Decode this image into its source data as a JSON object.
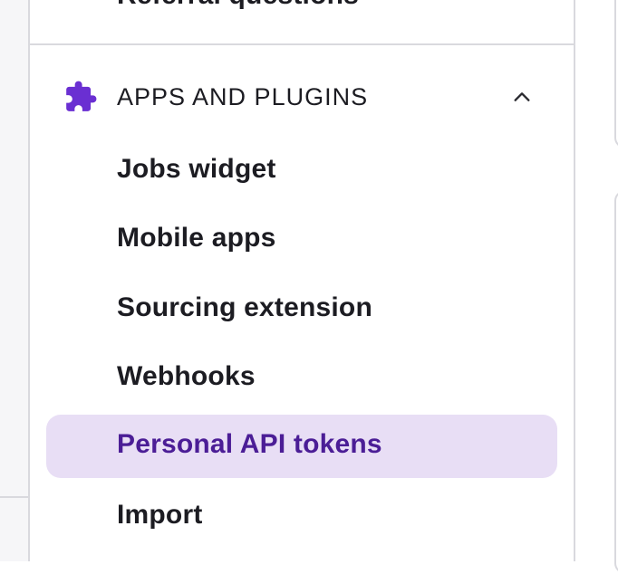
{
  "sidebar": {
    "previous_item": "Referral questions",
    "section": {
      "title": "APPS AND PLUGINS",
      "expanded": true,
      "icon": "puzzle-icon",
      "icon_color": "#6a2fd2"
    },
    "items": [
      {
        "label": "Jobs widget",
        "active": false
      },
      {
        "label": "Mobile apps",
        "active": false
      },
      {
        "label": "Sourcing extension",
        "active": false
      },
      {
        "label": "Webhooks",
        "active": false
      },
      {
        "label": "Personal API tokens",
        "active": true
      },
      {
        "label": "Import",
        "active": false
      }
    ]
  },
  "colors": {
    "active_background": "#e8def5",
    "active_text": "#4b1d96",
    "text": "#1c1c22",
    "border": "#d9d9de"
  }
}
